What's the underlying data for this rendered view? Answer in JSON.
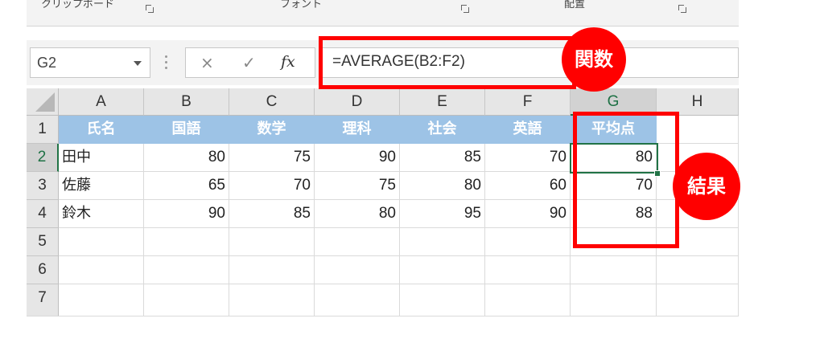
{
  "ribbon": {
    "groups": [
      {
        "label": "クリップボード"
      },
      {
        "label": "フォント"
      },
      {
        "label": "配置"
      }
    ]
  },
  "formula_bar": {
    "name_box": "G2",
    "cancel_icon": "×",
    "enter_icon": "✓",
    "fx_label": "fx",
    "formula": "=AVERAGE(B2:F2)"
  },
  "grid": {
    "columns": [
      "A",
      "B",
      "C",
      "D",
      "E",
      "F",
      "G",
      "H"
    ],
    "rows": [
      "1",
      "2",
      "3",
      "4",
      "5",
      "6",
      "7"
    ],
    "header_row": [
      "氏名",
      "国語",
      "数学",
      "理科",
      "社会",
      "英語",
      "平均点"
    ],
    "data_rows": [
      {
        "name": "田中",
        "scores": [
          "80",
          "75",
          "90",
          "85",
          "70"
        ],
        "average": "80"
      },
      {
        "name": "佐藤",
        "scores": [
          "65",
          "70",
          "75",
          "80",
          "60"
        ],
        "average": "70"
      },
      {
        "name": "鈴木",
        "scores": [
          "90",
          "85",
          "80",
          "95",
          "90"
        ],
        "average": "88"
      }
    ],
    "active_cell": "G2"
  },
  "annotations": {
    "function_label": "関数",
    "result_label": "結果",
    "accent_color": "#ff0000"
  },
  "colors": {
    "header_fill": "#9dc3e6",
    "selection": "#217346"
  }
}
